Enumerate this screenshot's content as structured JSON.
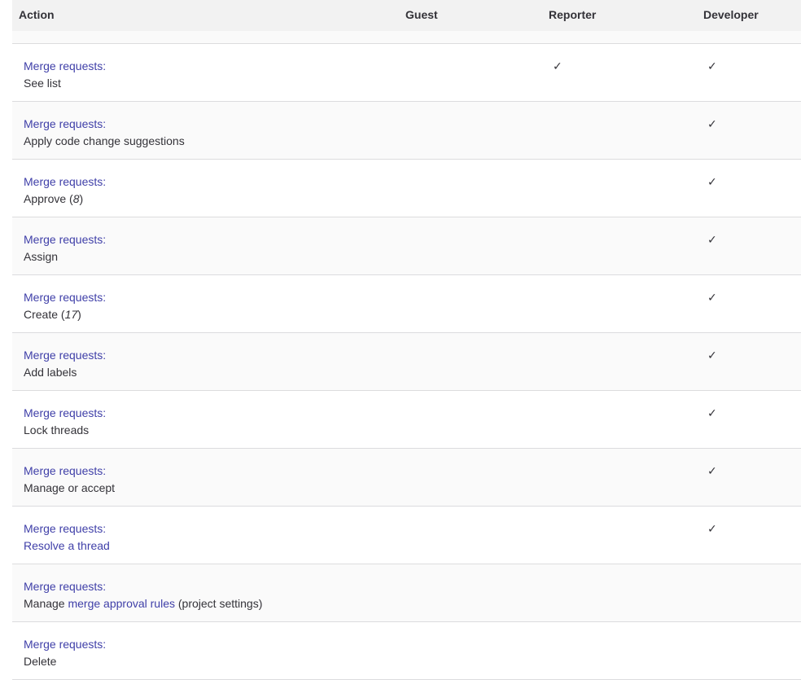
{
  "header": {
    "action": "Action",
    "guest": "Guest",
    "reporter": "Reporter",
    "developer": "Developer"
  },
  "check_glyph": "✓",
  "rows": [
    {
      "category": "Merge requests:",
      "desc_pre": "See list",
      "desc_note": "",
      "desc_post": "",
      "desc_link": "",
      "reporter": true,
      "developer": true
    },
    {
      "category": "Merge requests:",
      "desc_pre": "Apply code change suggestions",
      "desc_note": "",
      "desc_post": "",
      "desc_link": "",
      "reporter": false,
      "developer": true
    },
    {
      "category": "Merge requests:",
      "desc_pre": "Approve (",
      "desc_note": "8",
      "desc_post": ")",
      "desc_link": "",
      "reporter": false,
      "developer": true
    },
    {
      "category": "Merge requests:",
      "desc_pre": "Assign",
      "desc_note": "",
      "desc_post": "",
      "desc_link": "",
      "reporter": false,
      "developer": true
    },
    {
      "category": "Merge requests:",
      "desc_pre": "Create (",
      "desc_note": "17",
      "desc_post": ")",
      "desc_link": "",
      "reporter": false,
      "developer": true
    },
    {
      "category": "Merge requests:",
      "desc_pre": "Add labels",
      "desc_note": "",
      "desc_post": "",
      "desc_link": "",
      "reporter": false,
      "developer": true
    },
    {
      "category": "Merge requests:",
      "desc_pre": "Lock threads",
      "desc_note": "",
      "desc_post": "",
      "desc_link": "",
      "reporter": false,
      "developer": true
    },
    {
      "category": "Merge requests:",
      "desc_pre": "Manage or accept",
      "desc_note": "",
      "desc_post": "",
      "desc_link": "",
      "reporter": false,
      "developer": true
    },
    {
      "category": "Merge requests:",
      "desc_pre": "",
      "desc_note": "",
      "desc_post": "",
      "desc_link": "Resolve a thread",
      "reporter": false,
      "developer": true
    },
    {
      "category": "Merge requests:",
      "desc_pre": "Manage ",
      "desc_note": "",
      "desc_post": " (project settings)",
      "desc_link": "merge approval rules",
      "reporter": false,
      "developer": false
    },
    {
      "category": "Merge requests:",
      "desc_pre": "Delete",
      "desc_note": "",
      "desc_post": "",
      "desc_link": "",
      "reporter": false,
      "developer": false
    }
  ]
}
